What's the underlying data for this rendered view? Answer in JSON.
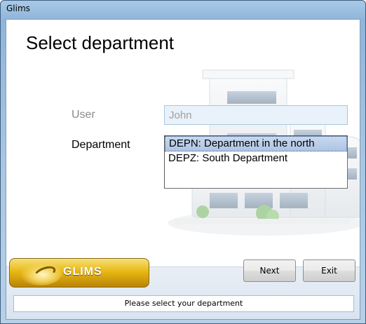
{
  "window": {
    "title": "Glims"
  },
  "page": {
    "title": "Select department"
  },
  "form": {
    "user_label": "User",
    "user_value": "John",
    "department_label": "Department",
    "departments": [
      {
        "label": "DEPN: Department in the north",
        "selected": true
      },
      {
        "label": "DEPZ: South Department",
        "selected": false
      }
    ]
  },
  "logo": {
    "text": "GLIMS",
    "colors": {
      "gold": "#e8b814"
    }
  },
  "buttons": {
    "next": "Next",
    "exit": "Exit"
  },
  "status": {
    "message": "Please select your department"
  },
  "icons": {
    "illustration": "building-icon"
  }
}
